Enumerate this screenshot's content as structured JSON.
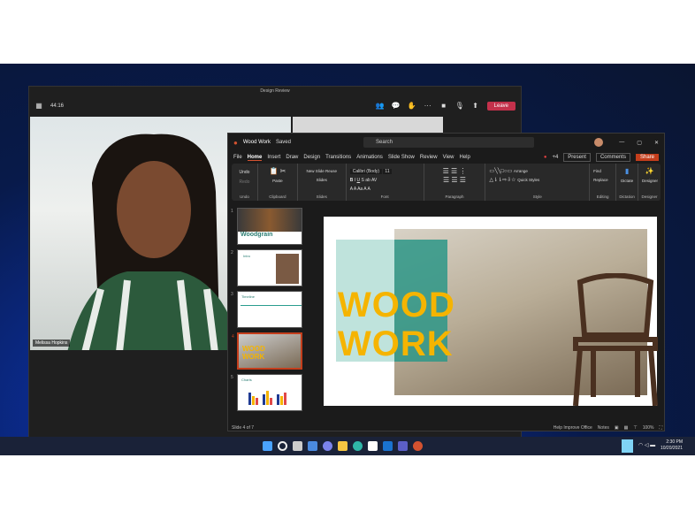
{
  "teams": {
    "title": "Design Review",
    "timer": "44:16",
    "leave": "Leave",
    "participant": "Melissa Hopkins"
  },
  "ppt": {
    "doc": "Wood Work",
    "saved": "Saved",
    "search": "Search",
    "presence_count": "+4",
    "menu": [
      "File",
      "Home",
      "Insert",
      "Draw",
      "Design",
      "Transitions",
      "Animations",
      "Slide Show",
      "Review",
      "View",
      "Help"
    ],
    "present": "Present",
    "comments": "Comments",
    "share": "Share",
    "ribbon": {
      "undo": "Undo",
      "redo": "Redo",
      "paste": "Paste",
      "new_slide": "New Slide",
      "reuse": "Reuse Slides",
      "font": "Calibri (Body)",
      "size": "11",
      "arrange": "Arrange",
      "quick_styles": "Quick Styles",
      "find": "Find",
      "replace": "Replace",
      "dictate": "Dictate",
      "designer": "Designer",
      "groups": [
        "Undo",
        "Clipboard",
        "Slides",
        "Font",
        "Paragraph",
        "Style",
        "Editing",
        "Dictation",
        "Designer"
      ]
    },
    "thumbs": [
      {
        "n": "1",
        "t": "Woodgrain"
      },
      {
        "n": "2",
        "t": "Intro"
      },
      {
        "n": "3",
        "t": "Timeline"
      },
      {
        "n": "4",
        "t": "WOOD WORK"
      },
      {
        "n": "5",
        "t": "Charts"
      }
    ],
    "slide": {
      "line1": "WOOD",
      "line2": "WORK"
    },
    "status": {
      "slide": "Slide 4 of 7",
      "help": "Help Improve Office",
      "notes": "Notes",
      "zoom": "100%"
    }
  },
  "taskbar": {
    "time": "2:30 PM",
    "date": "10/20/2021"
  },
  "colors": {
    "accent": "#c43e1c",
    "leave": "#c4314b",
    "title_yellow": "#f5b400",
    "teal": "#2d9687"
  }
}
